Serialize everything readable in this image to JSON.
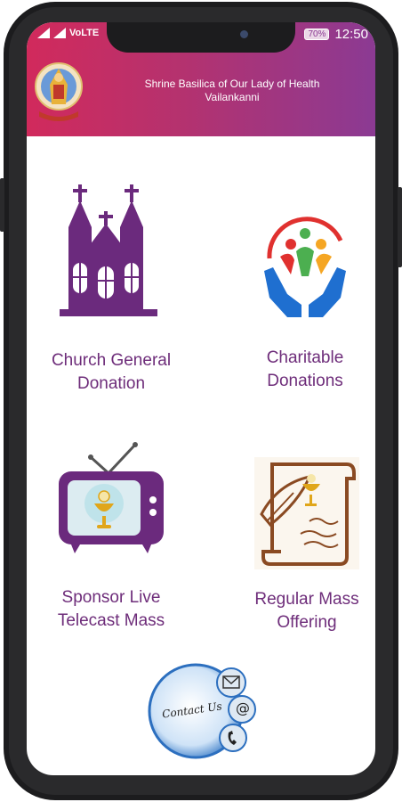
{
  "status": {
    "carrier_left": "VoLTE",
    "battery": "70%",
    "time": "12:50"
  },
  "header": {
    "title_line1": "Shrine Basilica of Our Lady of Health",
    "title_line2": "Vailankanni"
  },
  "tiles": [
    {
      "label_line1": "Church General",
      "label_line2": "Donation",
      "icon": "church-icon"
    },
    {
      "label_line1": "Charitable",
      "label_line2": "Donations",
      "icon": "charity-hands-icon"
    },
    {
      "label_line1": "Sponsor Live",
      "label_line2": "Telecast Mass",
      "icon": "tv-chalice-icon"
    },
    {
      "label_line1": "Regular Mass",
      "label_line2": "Offering",
      "icon": "scroll-quill-icon"
    }
  ],
  "contact": {
    "label": "Contact Us",
    "icon": "contact-us-icon"
  },
  "colors": {
    "accent_start": "#d12a5c",
    "accent_end": "#8b3a93",
    "label": "#6e2d7a"
  }
}
